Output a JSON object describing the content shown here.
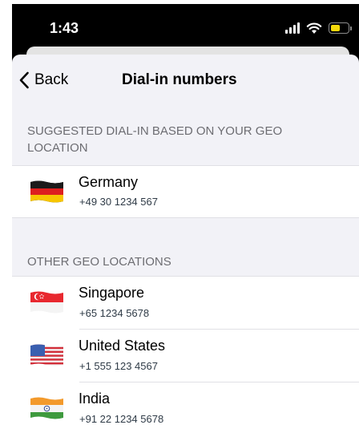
{
  "status_bar": {
    "time": "1:43",
    "battery_level": 0.55,
    "battery_color": "#f5d90a",
    "icons": [
      "signal-icon",
      "wifi-icon",
      "battery-icon"
    ]
  },
  "nav": {
    "back_label": "Back",
    "title": "Dial-in numbers",
    "back_icon": "chevron-left-icon"
  },
  "suggested": {
    "header": "SUGGESTED DIAL-IN BASED ON YOUR GEO LOCATION",
    "items": [
      {
        "country": "Germany",
        "number": "+49 30 1234 567",
        "flag": "germany-flag-icon"
      }
    ]
  },
  "other": {
    "header": "OTHER GEO LOCATIONS",
    "items": [
      {
        "country": "Singapore",
        "number": "+65 1234 5678",
        "flag": "singapore-flag-icon"
      },
      {
        "country": "United States",
        "number": "+1 555 123 4567",
        "flag": "us-flag-icon"
      },
      {
        "country": "India",
        "number": "+91 22 1234 5678",
        "flag": "india-flag-icon"
      }
    ]
  }
}
